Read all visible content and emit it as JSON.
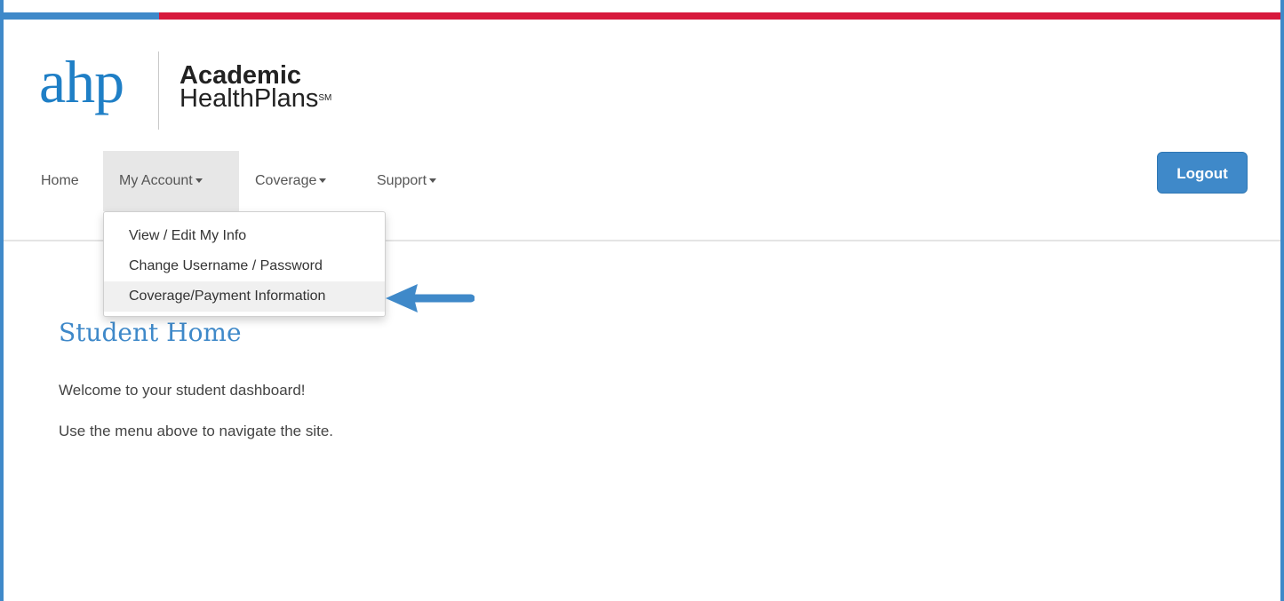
{
  "brand": {
    "logo_mark": "ahp",
    "logo_line1": "Academic",
    "logo_line2": "HealthPlans",
    "logo_sm": "SM",
    "colors": {
      "primary": "#3f89c9",
      "accent_red": "#d7193c",
      "logo_blue": "#1f7fc6"
    }
  },
  "nav": {
    "items": [
      {
        "label": "Home",
        "has_caret": false
      },
      {
        "label": "My Account",
        "has_caret": true,
        "active": true
      },
      {
        "label": "Coverage",
        "has_caret": true
      },
      {
        "label": "Support",
        "has_caret": true
      }
    ],
    "logout_label": "Logout"
  },
  "dropdown": {
    "items": [
      {
        "label": "View / Edit My Info"
      },
      {
        "label": "Change Username / Password"
      },
      {
        "label": "Coverage/Payment Information",
        "highlighted": true
      }
    ],
    "pointer_icon": "arrow-left-icon"
  },
  "main": {
    "title": "Student Home",
    "paragraphs": [
      "Welcome to your student dashboard!",
      "Use the menu above to navigate the site."
    ]
  }
}
